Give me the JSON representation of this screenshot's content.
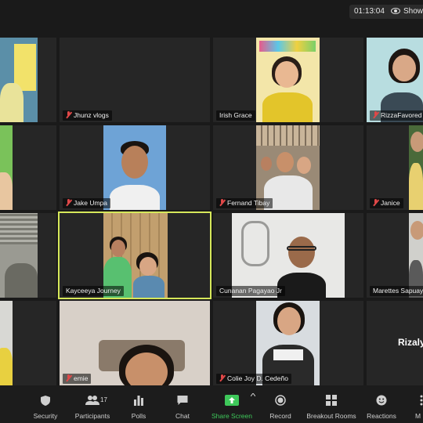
{
  "meeting": {
    "timer": "01:13:04",
    "show_label": "Show S"
  },
  "participants": [
    {
      "name": "",
      "muted": false
    },
    {
      "name": "Jhunz vlogs",
      "muted": true
    },
    {
      "name": "Irish Grace",
      "muted": false
    },
    {
      "name": "RizzaFavored",
      "muted": true
    },
    {
      "name": "",
      "muted": false
    },
    {
      "name": "Jake Umpa",
      "muted": true
    },
    {
      "name": "Fernand Tibay",
      "muted": true
    },
    {
      "name": "Janice",
      "muted": true
    },
    {
      "name": "",
      "muted": false
    },
    {
      "name": "Kayceeya Journey",
      "muted": false
    },
    {
      "name": "Cunanan Pagayao Jr",
      "muted": false
    },
    {
      "name": "Marettes Sapuay",
      "muted": false
    },
    {
      "name": "",
      "muted": false
    },
    {
      "name": "emie",
      "muted": true
    },
    {
      "name": "Colie Joy D. Cedeño",
      "muted": true
    },
    {
      "name": "Rizaly",
      "muted": false
    }
  ],
  "toolbar": {
    "security": "Security",
    "participants": "Participants",
    "participants_count": "17",
    "polls": "Polls",
    "chat": "Chat",
    "share_screen": "Share Screen",
    "record": "Record",
    "breakout_rooms": "Breakout Rooms",
    "reactions": "Reactions",
    "more": "M"
  },
  "colors": {
    "active_speaker_border": "#d6e85a",
    "share_screen_green": "#3ec85a",
    "muted_red": "#e04848"
  }
}
